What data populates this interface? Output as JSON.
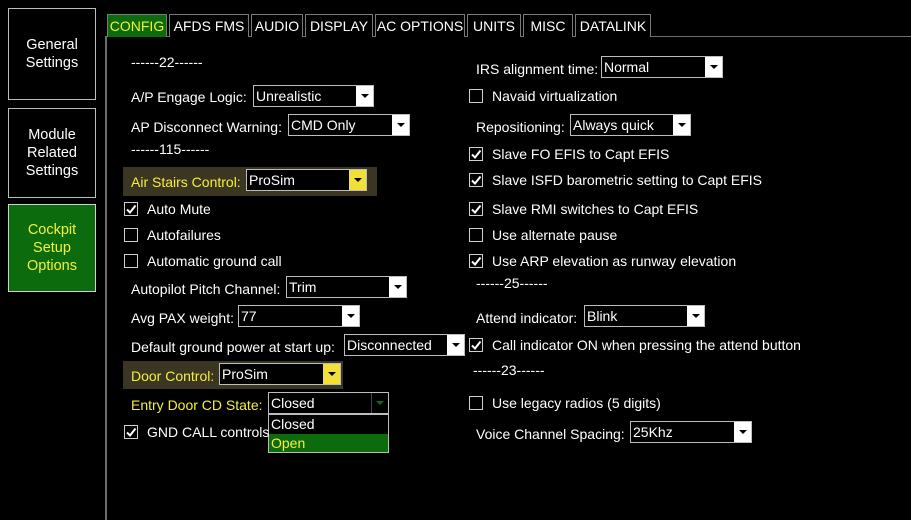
{
  "sidebar": {
    "items": [
      {
        "label": "General\nSettings"
      },
      {
        "label": "Module\nRelated\nSettings"
      },
      {
        "label": "Cockpit\nSetup\nOptions"
      }
    ]
  },
  "tabs": [
    "CONFIG",
    "AFDS FMS",
    "AUDIO",
    "DISPLAY",
    "AC OPTIONS",
    "UNITS",
    "MISC",
    "DATALINK"
  ],
  "left": {
    "section_22": "------22------",
    "ap_engage_label": "A/P Engage Logic:",
    "ap_engage_value": "Unrealistic",
    "ap_disconnect_label": "AP Disconnect Warning:",
    "ap_disconnect_value": "CMD Only",
    "section_115": "------115------",
    "air_stairs_label": "Air Stairs Control:",
    "air_stairs_value": "ProSim",
    "auto_mute_label": "Auto Mute",
    "autofailures_label": "Autofailures",
    "auto_ground_call_label": "Automatic ground call",
    "autopilot_pitch_label": "Autopilot Pitch Channel:",
    "autopilot_pitch_value": "Trim",
    "avg_pax_label": "Avg PAX weight:",
    "avg_pax_value": "77",
    "default_gpu_label": "Default ground power at start up:",
    "default_gpu_value": "Disconnected",
    "door_control_label": "Door Control:",
    "door_control_value": "ProSim",
    "entry_door_label": "Entry Door CD State:",
    "entry_door_value": "Closed",
    "entry_door_options": [
      "Closed",
      "Open"
    ],
    "gnd_call_label": "GND CALL controls"
  },
  "right": {
    "irs_label": "IRS alignment time:",
    "irs_value": "Normal",
    "navaid_label": "Navaid virtualization",
    "repositioning_label": "Repositioning:",
    "repositioning_value": "Always quick",
    "slave_fo_label": "Slave FO EFIS to Capt EFIS",
    "slave_isfd_label": "Slave ISFD barometric setting to Capt EFIS",
    "slave_rmi_label": "Slave RMI switches to Capt EFIS",
    "alt_pause_label": "Use alternate pause",
    "arp_elev_label": "Use ARP elevation as runway elevation",
    "section_25": "------25------",
    "attend_label": "Attend indicator:",
    "attend_value": "Blink",
    "call_ind_label": "Call indicator ON when pressing the attend button",
    "section_23": "------23------",
    "legacy_radios_label": "Use legacy radios (5 digits)",
    "voice_spacing_label": "Voice Channel Spacing:",
    "voice_spacing_value": "25Khz"
  },
  "checkboxes": {
    "auto_mute": true,
    "autofailures": false,
    "auto_ground_call": false,
    "gnd_call": true,
    "navaid": false,
    "slave_fo": true,
    "slave_isfd": true,
    "slave_rmi": true,
    "alt_pause": false,
    "arp_elev": true,
    "call_ind": true,
    "legacy_radios": false
  },
  "colors": {
    "accent_green": "#0c6b0c",
    "accent_yellow": "#f5ef3c",
    "highlight_row": "#3b3622"
  }
}
